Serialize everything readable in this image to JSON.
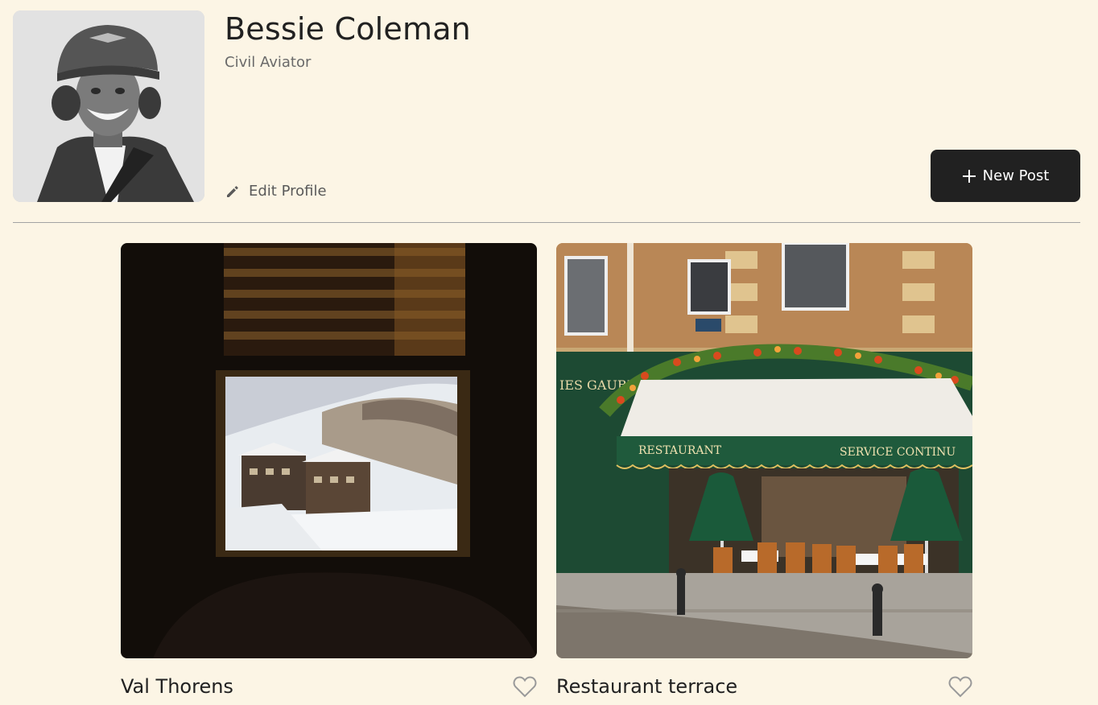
{
  "profile": {
    "name": "Bessie Coleman",
    "job": "Civil Aviator",
    "edit_label": "Edit Profile",
    "avatar_icon": "profile-photo"
  },
  "actions": {
    "new_post_label": "New Post",
    "new_post_icon": "plus-icon"
  },
  "cards": [
    {
      "title": "Val Thorens",
      "liked": false,
      "image_icon": "val-thorens-photo"
    },
    {
      "title": "Restaurant terrace",
      "liked": false,
      "image_icon": "restaurant-terrace-photo"
    }
  ],
  "colors": {
    "background": "#fcf5e5",
    "text": "#212121",
    "button_bg": "#212121",
    "muted": "#6a6a6a"
  }
}
